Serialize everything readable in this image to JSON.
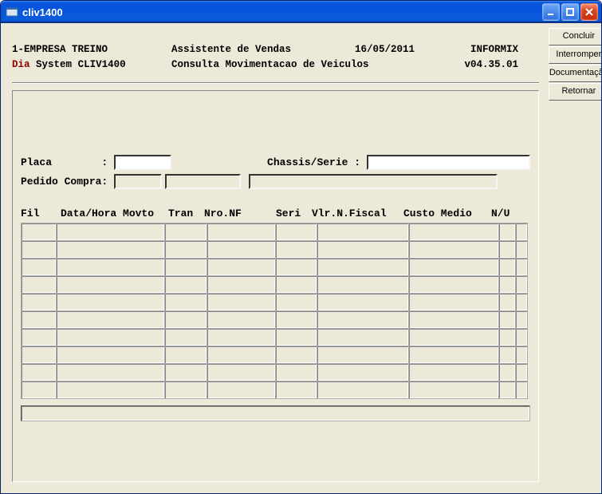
{
  "window": {
    "title": "cliv1400"
  },
  "side": {
    "concluir": "Concluir",
    "interromper": "Interromper",
    "documentacao": "Documentação",
    "retornar": "Retornar"
  },
  "header": {
    "company": "1-EMPRESA TREINO",
    "title": "Assistente de Vendas",
    "date": "16/05/2011",
    "db": "INFORMIX",
    "dia": "Dia",
    "system": "System",
    "code": "CLIV1400",
    "subtitle": "Consulta Movimentacao de Veiculos",
    "version": "v04.35.01"
  },
  "form": {
    "placa_label": "Placa",
    "chassis_label": "Chassis/Serie",
    "pedido_label": "Pedido Compra",
    "placa_value": "",
    "chassis_value": "",
    "pedido1": "",
    "pedido2": "",
    "pedido3": ""
  },
  "columns": {
    "fil": "Fil",
    "data_hora": "Data/Hora Movto",
    "tran": "Tran",
    "nro_nf": "Nro.NF",
    "seri": "Seri",
    "vlr_fiscal": "Vlr.N.Fiscal",
    "custo_medio": "Custo Medio",
    "nu": "N/U"
  },
  "grid": {
    "rows": 10
  },
  "status": ""
}
